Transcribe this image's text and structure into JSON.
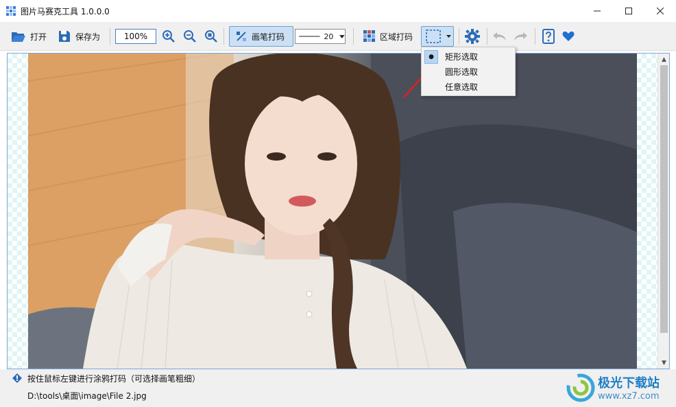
{
  "window": {
    "title": "图片马赛克工具 1.0.0.0",
    "minimize_icon": "minimize-icon",
    "maximize_icon": "maximize-icon",
    "close_icon": "close-icon"
  },
  "toolbar": {
    "open_label": "打开",
    "save_as_label": "保存为",
    "zoom_value": "100%",
    "brush_label": "画笔打码",
    "pen_size_value": "20",
    "region_label": "区域打码"
  },
  "selection_menu": {
    "items": [
      {
        "label": "矩形选取",
        "selected": true
      },
      {
        "label": "圆形选取",
        "selected": false
      },
      {
        "label": "任意选取",
        "selected": false
      }
    ]
  },
  "status": {
    "hint": "按住鼠标左键进行涂鸦打码（可选择画笔粗细）",
    "file_path": "D:\\tools\\桌面\\image\\File 2.jpg"
  },
  "watermark": {
    "name": "极光下载站",
    "url": "www.xz7.com"
  },
  "colors": {
    "accent": "#2b6cb8",
    "pressed_bg": "#cce0f5",
    "heart": "#1f6fd1"
  }
}
